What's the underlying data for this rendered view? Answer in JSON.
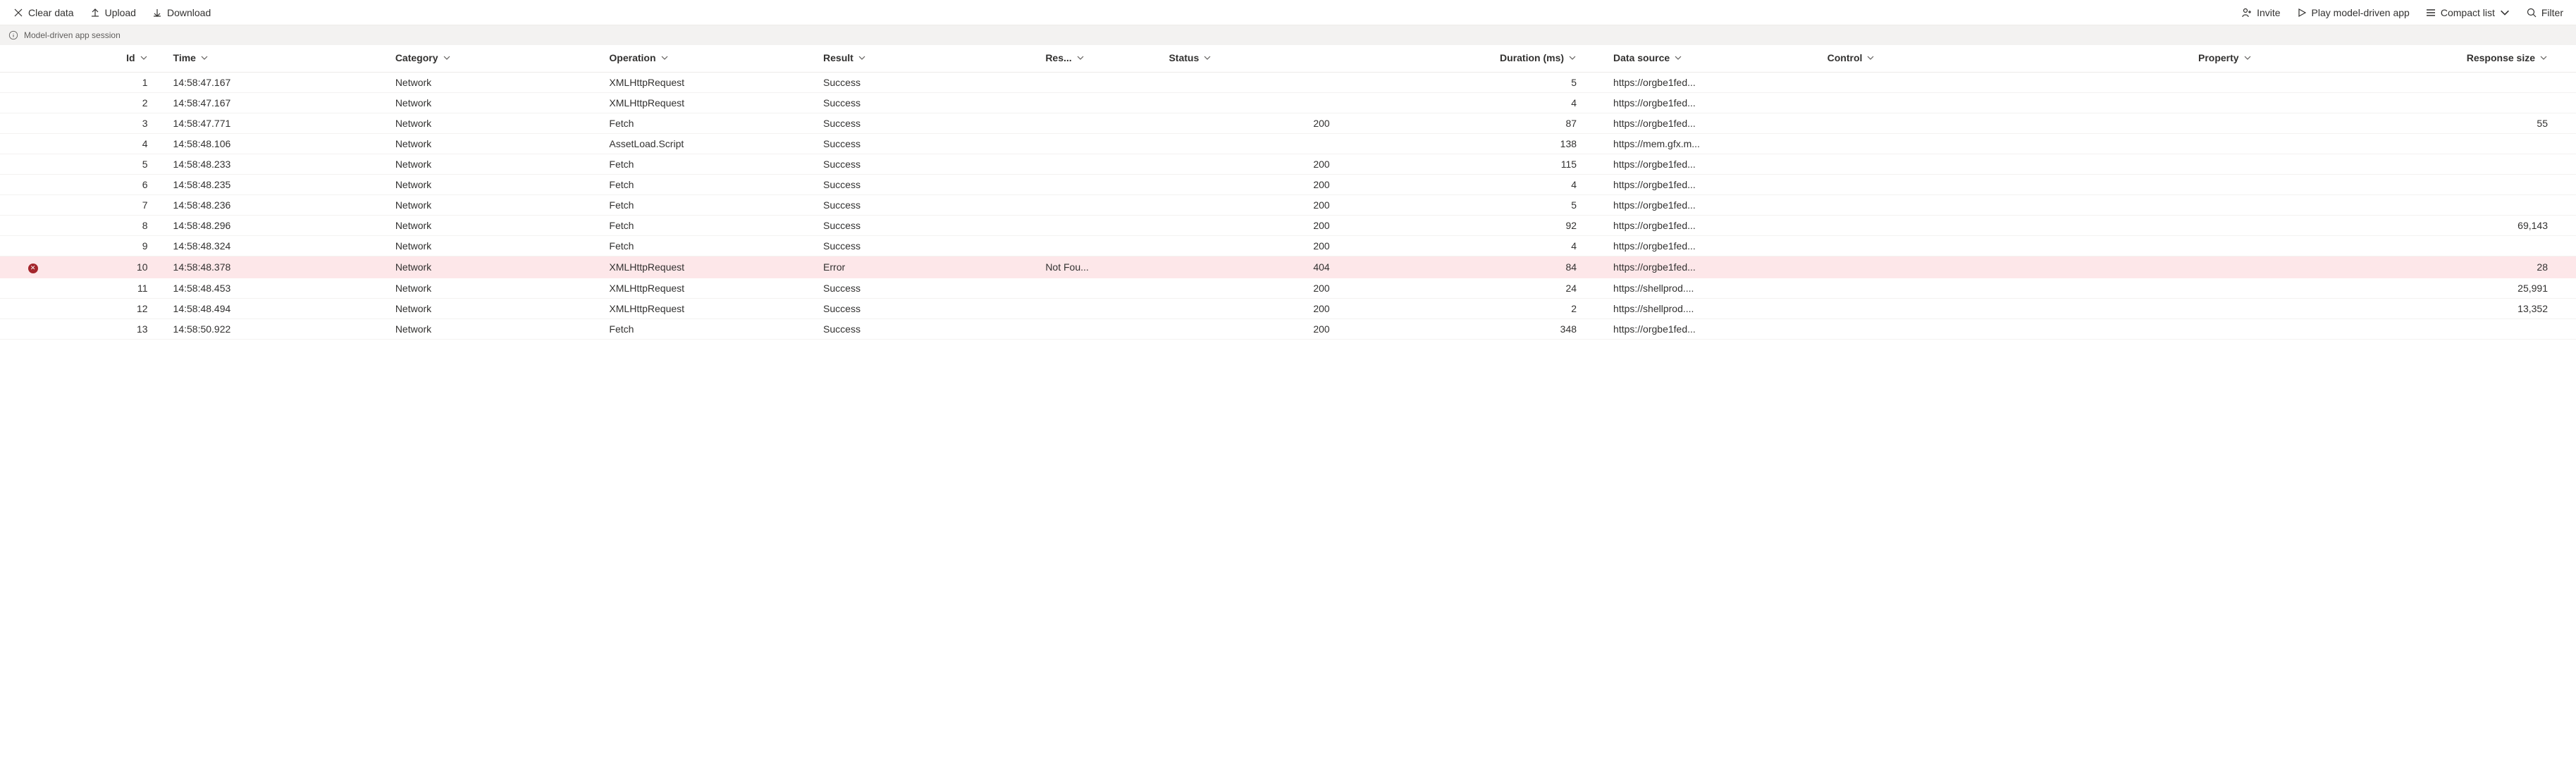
{
  "toolbar": {
    "clear_label": "Clear data",
    "upload_label": "Upload",
    "download_label": "Download",
    "invite_label": "Invite",
    "play_label": "Play model-driven app",
    "view_label": "Compact list",
    "filter_label": "Filter"
  },
  "session": {
    "label": "Model-driven app session"
  },
  "columns": {
    "id": "Id",
    "time": "Time",
    "category": "Category",
    "operation": "Operation",
    "result": "Result",
    "res": "Res...",
    "status": "Status",
    "duration": "Duration (ms)",
    "datasource": "Data source",
    "control": "Control",
    "property": "Property",
    "responsesize": "Response size"
  },
  "rows": [
    {
      "id": "1",
      "time": "14:58:47.167",
      "category": "Network",
      "operation": "XMLHttpRequest",
      "result": "Success",
      "res": "",
      "status": "",
      "duration": "5",
      "datasource": "https://orgbe1fed...",
      "control": "",
      "property": "",
      "responsesize": "",
      "error": false
    },
    {
      "id": "2",
      "time": "14:58:47.167",
      "category": "Network",
      "operation": "XMLHttpRequest",
      "result": "Success",
      "res": "",
      "status": "",
      "duration": "4",
      "datasource": "https://orgbe1fed...",
      "control": "",
      "property": "",
      "responsesize": "",
      "error": false
    },
    {
      "id": "3",
      "time": "14:58:47.771",
      "category": "Network",
      "operation": "Fetch",
      "result": "Success",
      "res": "",
      "status": "200",
      "duration": "87",
      "datasource": "https://orgbe1fed...",
      "control": "",
      "property": "",
      "responsesize": "55",
      "error": false
    },
    {
      "id": "4",
      "time": "14:58:48.106",
      "category": "Network",
      "operation": "AssetLoad.Script",
      "result": "Success",
      "res": "",
      "status": "",
      "duration": "138",
      "datasource": "https://mem.gfx.m...",
      "control": "",
      "property": "",
      "responsesize": "",
      "error": false
    },
    {
      "id": "5",
      "time": "14:58:48.233",
      "category": "Network",
      "operation": "Fetch",
      "result": "Success",
      "res": "",
      "status": "200",
      "duration": "115",
      "datasource": "https://orgbe1fed...",
      "control": "",
      "property": "",
      "responsesize": "",
      "error": false
    },
    {
      "id": "6",
      "time": "14:58:48.235",
      "category": "Network",
      "operation": "Fetch",
      "result": "Success",
      "res": "",
      "status": "200",
      "duration": "4",
      "datasource": "https://orgbe1fed...",
      "control": "",
      "property": "",
      "responsesize": "",
      "error": false
    },
    {
      "id": "7",
      "time": "14:58:48.236",
      "category": "Network",
      "operation": "Fetch",
      "result": "Success",
      "res": "",
      "status": "200",
      "duration": "5",
      "datasource": "https://orgbe1fed...",
      "control": "",
      "property": "",
      "responsesize": "",
      "error": false
    },
    {
      "id": "8",
      "time": "14:58:48.296",
      "category": "Network",
      "operation": "Fetch",
      "result": "Success",
      "res": "",
      "status": "200",
      "duration": "92",
      "datasource": "https://orgbe1fed...",
      "control": "",
      "property": "",
      "responsesize": "69,143",
      "error": false
    },
    {
      "id": "9",
      "time": "14:58:48.324",
      "category": "Network",
      "operation": "Fetch",
      "result": "Success",
      "res": "",
      "status": "200",
      "duration": "4",
      "datasource": "https://orgbe1fed...",
      "control": "",
      "property": "",
      "responsesize": "",
      "error": false
    },
    {
      "id": "10",
      "time": "14:58:48.378",
      "category": "Network",
      "operation": "XMLHttpRequest",
      "result": "Error",
      "res": "Not Fou...",
      "status": "404",
      "duration": "84",
      "datasource": "https://orgbe1fed...",
      "control": "",
      "property": "",
      "responsesize": "28",
      "error": true
    },
    {
      "id": "11",
      "time": "14:58:48.453",
      "category": "Network",
      "operation": "XMLHttpRequest",
      "result": "Success",
      "res": "",
      "status": "200",
      "duration": "24",
      "datasource": "https://shellprod....",
      "control": "",
      "property": "",
      "responsesize": "25,991",
      "error": false
    },
    {
      "id": "12",
      "time": "14:58:48.494",
      "category": "Network",
      "operation": "XMLHttpRequest",
      "result": "Success",
      "res": "",
      "status": "200",
      "duration": "2",
      "datasource": "https://shellprod....",
      "control": "",
      "property": "",
      "responsesize": "13,352",
      "error": false
    },
    {
      "id": "13",
      "time": "14:58:50.922",
      "category": "Network",
      "operation": "Fetch",
      "result": "Success",
      "res": "",
      "status": "200",
      "duration": "348",
      "datasource": "https://orgbe1fed...",
      "control": "",
      "property": "",
      "responsesize": "",
      "error": false
    }
  ]
}
